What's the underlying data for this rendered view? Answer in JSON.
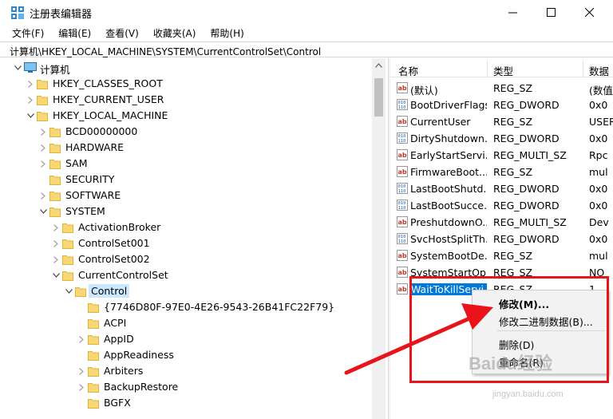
{
  "window": {
    "title": "注册表编辑器"
  },
  "menu": [
    "文件(F)",
    "编辑(E)",
    "查看(V)",
    "收藏夹(A)",
    "帮助(H)"
  ],
  "address": "计算机\\HKEY_LOCAL_MACHINE\\SYSTEM\\CurrentControlSet\\Control",
  "tree": [
    {
      "label": "计算机",
      "depth": 0,
      "expanded": true,
      "type": "computer"
    },
    {
      "label": "HKEY_CLASSES_ROOT",
      "depth": 1,
      "expanded": false
    },
    {
      "label": "HKEY_CURRENT_USER",
      "depth": 1,
      "expanded": false
    },
    {
      "label": "HKEY_LOCAL_MACHINE",
      "depth": 1,
      "expanded": true
    },
    {
      "label": "BCD00000000",
      "depth": 2,
      "expanded": false
    },
    {
      "label": "HARDWARE",
      "depth": 2,
      "expanded": false
    },
    {
      "label": "SAM",
      "depth": 2,
      "expanded": false
    },
    {
      "label": "SECURITY",
      "depth": 2,
      "expanded": false,
      "leaf": true
    },
    {
      "label": "SOFTWARE",
      "depth": 2,
      "expanded": false
    },
    {
      "label": "SYSTEM",
      "depth": 2,
      "expanded": true
    },
    {
      "label": "ActivationBroker",
      "depth": 3,
      "expanded": false
    },
    {
      "label": "ControlSet001",
      "depth": 3,
      "expanded": false
    },
    {
      "label": "ControlSet002",
      "depth": 3,
      "expanded": false
    },
    {
      "label": "CurrentControlSet",
      "depth": 3,
      "expanded": true
    },
    {
      "label": "Control",
      "depth": 4,
      "expanded": true,
      "selected": true
    },
    {
      "label": "{7746D80F-97E0-4E26-9543-26B41FC22F79}",
      "depth": 5,
      "leaf": true
    },
    {
      "label": "ACPI",
      "depth": 5,
      "leaf": true
    },
    {
      "label": "AppID",
      "depth": 5,
      "expanded": false
    },
    {
      "label": "AppReadiness",
      "depth": 5,
      "leaf": true
    },
    {
      "label": "Arbiters",
      "depth": 5,
      "expanded": false
    },
    {
      "label": "BackupRestore",
      "depth": 5,
      "expanded": false
    },
    {
      "label": "BGFX",
      "depth": 5,
      "leaf": true
    }
  ],
  "list": {
    "columns": [
      "名称",
      "类型",
      "数据"
    ],
    "rows": [
      {
        "name": "(默认)",
        "type": "REG_SZ",
        "data": "(数值",
        "icon": "string-value-icon"
      },
      {
        "name": "BootDriverFlags",
        "type": "REG_DWORD",
        "data": "0x0",
        "icon": "binary-value-icon"
      },
      {
        "name": "CurrentUser",
        "type": "REG_SZ",
        "data": "USER",
        "icon": "string-value-icon"
      },
      {
        "name": "DirtyShutdown...",
        "type": "REG_DWORD",
        "data": "0x0",
        "icon": "binary-value-icon"
      },
      {
        "name": "EarlyStartServi...",
        "type": "REG_MULTI_SZ",
        "data": "Rpc",
        "icon": "string-value-icon"
      },
      {
        "name": "FirmwareBoot...",
        "type": "REG_SZ",
        "data": "mul",
        "icon": "string-value-icon"
      },
      {
        "name": "LastBootShutd...",
        "type": "REG_DWORD",
        "data": "0x0",
        "icon": "binary-value-icon"
      },
      {
        "name": "LastBootSucce...",
        "type": "REG_DWORD",
        "data": "0x0",
        "icon": "binary-value-icon"
      },
      {
        "name": "PreshutdownO...",
        "type": "REG_MULTI_SZ",
        "data": "Dev",
        "icon": "string-value-icon"
      },
      {
        "name": "SvcHostSplitTh...",
        "type": "REG_DWORD",
        "data": "0x0",
        "icon": "binary-value-icon"
      },
      {
        "name": "SystemBootDe...",
        "type": "REG_SZ",
        "data": "mul",
        "icon": "string-value-icon"
      },
      {
        "name": "SystemStartOp...",
        "type": "REG_SZ",
        "data": "NO",
        "icon": "string-value-icon"
      },
      {
        "name": "WaitToKillServi...",
        "type": "REG_SZ",
        "data": "1",
        "icon": "string-value-icon",
        "selected": true
      }
    ]
  },
  "context_menu": {
    "items": [
      "修改(M)...",
      "修改二进制数据(B)...",
      "删除(D)",
      "重命名(R)"
    ]
  },
  "annotation": {
    "color": "#e8141a"
  },
  "watermark": {
    "main": "Baidu经验",
    "sub": "jingyan.baidu.com"
  }
}
